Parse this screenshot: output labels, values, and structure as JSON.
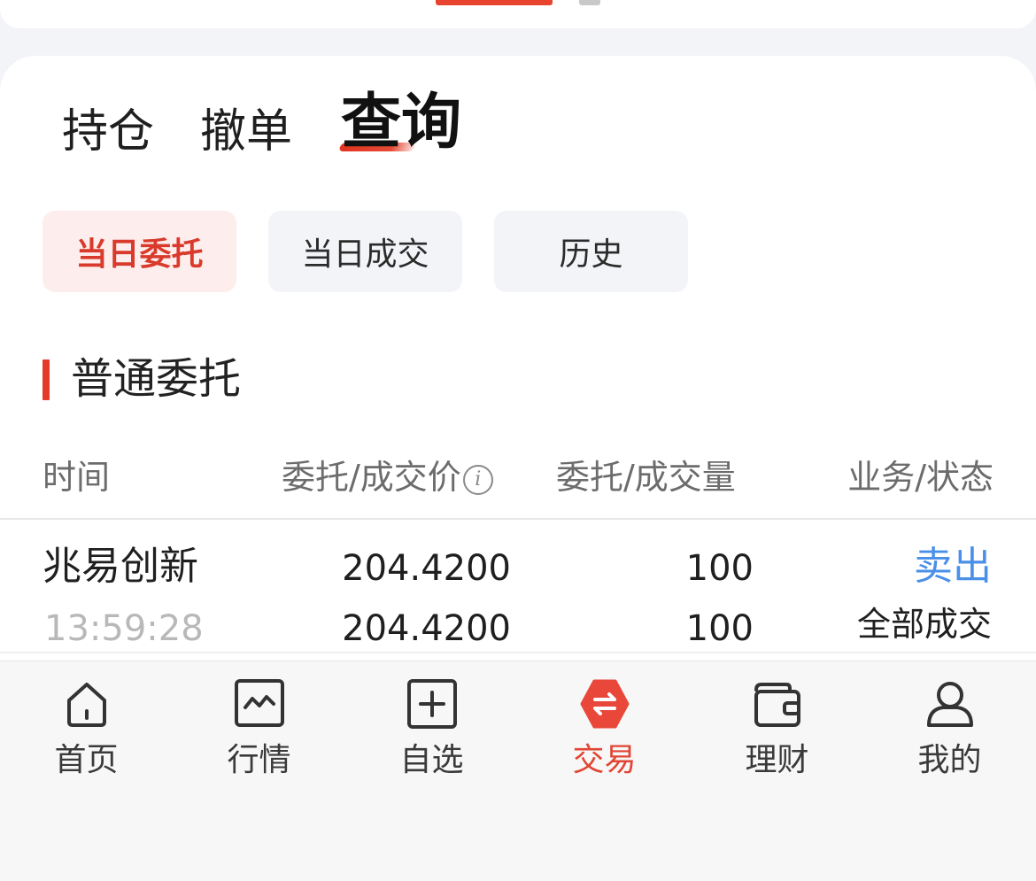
{
  "colors": {
    "accent": "#e5392a",
    "active_chip_bg": "#fdeeed",
    "link_blue": "#4a8fe8",
    "muted_text": "#b8b8b8"
  },
  "tabs": [
    {
      "label": "持仓",
      "active": false
    },
    {
      "label": "撤单",
      "active": false
    },
    {
      "label": "查询",
      "active": true
    }
  ],
  "filter_chips": [
    {
      "label": "当日委托",
      "active": true
    },
    {
      "label": "当日成交",
      "active": false
    },
    {
      "label": "历史",
      "active": false
    }
  ],
  "section": {
    "title": "普通委托"
  },
  "table": {
    "headers": [
      "时间",
      "委托/成交价",
      "委托/成交量",
      "业务/状态"
    ],
    "info_icon": "info-icon",
    "rows": [
      {
        "name": "兆易创新",
        "time": "13:59:28",
        "order_price": "204.4200",
        "deal_price": "204.4200",
        "order_qty": "100",
        "deal_qty": "100",
        "business": "卖出",
        "status": "全部成交"
      }
    ]
  },
  "bottom_nav": [
    {
      "label": "首页",
      "icon": "home-icon",
      "active": false
    },
    {
      "label": "行情",
      "icon": "chart-icon",
      "active": false
    },
    {
      "label": "自选",
      "icon": "add-square-icon",
      "active": false
    },
    {
      "label": "交易",
      "icon": "exchange-icon",
      "active": true
    },
    {
      "label": "理财",
      "icon": "wallet-icon",
      "active": false
    },
    {
      "label": "我的",
      "icon": "user-icon",
      "active": false
    }
  ]
}
